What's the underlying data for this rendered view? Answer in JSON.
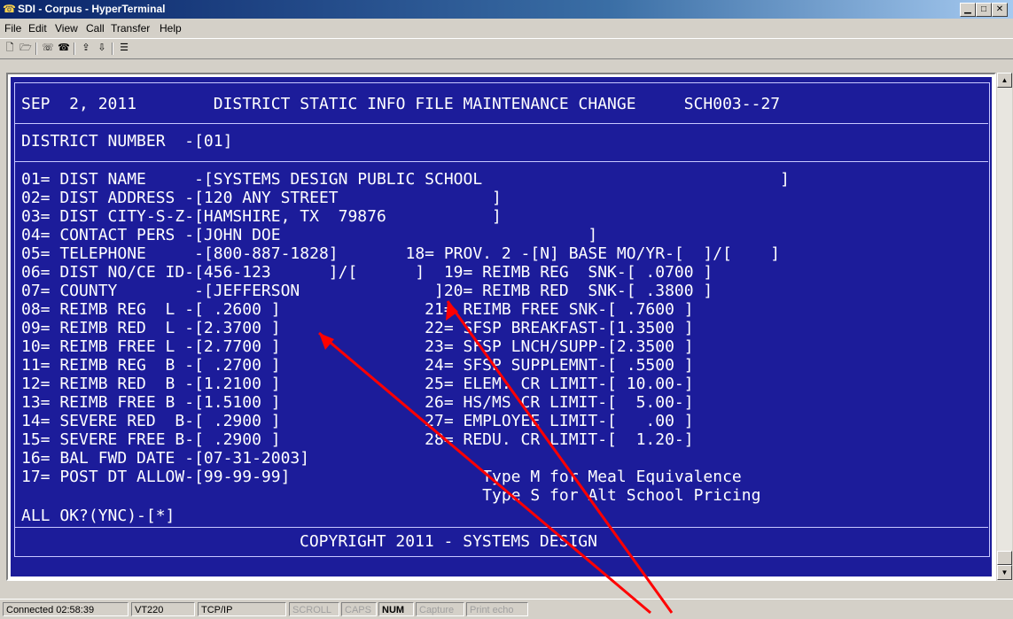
{
  "window": {
    "title": "SDI - Corpus - HyperTerminal"
  },
  "menu": [
    {
      "label": "File"
    },
    {
      "label": "Edit"
    },
    {
      "label": "View"
    },
    {
      "label": "Call"
    },
    {
      "label": "Transfer"
    },
    {
      "label": "Help"
    }
  ],
  "toolbar": {
    "icons": [
      "new-icon",
      "open-icon",
      "connect-icon",
      "disconnect-icon",
      "send-icon",
      "receive-icon",
      "properties-icon"
    ]
  },
  "terminal": {
    "header": "SEP  2, 2011        DISTRICT STATIC INFO FILE MAINTENANCE CHANGE     SCH003--27",
    "district": "DISTRICT NUMBER  -[01]",
    "lines": [
      "01= DIST NAME     -[SYSTEMS DESIGN PUBLIC SCHOOL                               ]",
      "02= DIST ADDRESS -[120 ANY STREET                ]",
      "03= DIST CITY-S-Z-[HAMSHIRE, TX  79876           ]",
      "04= CONTACT PERS -[JOHN DOE                                ]",
      "05= TELEPHONE     -[800-887-1828]       18= PROV. 2 -[N] BASE MO/YR-[  ]/[    ]",
      "06= DIST NO/CE ID-[456-123      ]/[      ]  19= REIMB REG  SNK-[ .0700 ]",
      "07= COUNTY        -[JEFFERSON              ]20= REIMB RED  SNK-[ .3800 ]",
      "08= REIMB REG  L -[ .2600 ]               21= REIMB FREE SNK-[ .7600 ]",
      "09= REIMB RED  L -[2.3700 ]               22= SFSP BREAKFAST-[1.3500 ]",
      "10= REIMB FREE L -[2.7700 ]               23= SFSP LNCH/SUPP-[2.3500 ]",
      "11= REIMB REG  B -[ .2700 ]               24= SFSP SUPPLEMNT-[ .5500 ]",
      "12= REIMB RED  B -[1.2100 ]               25= ELEM. CR LIMIT-[ 10.00-]",
      "13= REIMB FREE B -[1.5100 ]               26= HS/MS CR LIMIT-[  5.00-]",
      "14= SEVERE RED  B-[ .2900 ]               27= EMPLOYEE LIMIT-[   .00 ]",
      "15= SEVERE FREE B-[ .2900 ]               28= REDU. CR LIMIT-[  1.20-]",
      "16= BAL FWD DATE -[07-31-2003]",
      "17= POST DT ALLOW-[99-99-99]                    Type M for Meal Equivalence",
      "                                                Type S for Alt School Pricing",
      "ALL OK?(YNC)-[*]"
    ],
    "copyright": "COPYRIGHT 2011 - SYSTEMS DESIGN",
    "colors": {
      "background": "#1c1c9a",
      "text": "#ffffff",
      "annotation_arrow": "#ff0000"
    }
  },
  "status": {
    "connected": "Connected 02:58:39",
    "emulation": "VT220",
    "protocol": "TCP/IP",
    "scroll": "SCROLL",
    "caps": "CAPS",
    "num": "NUM",
    "capture": "Capture",
    "print_echo": "Print echo"
  }
}
